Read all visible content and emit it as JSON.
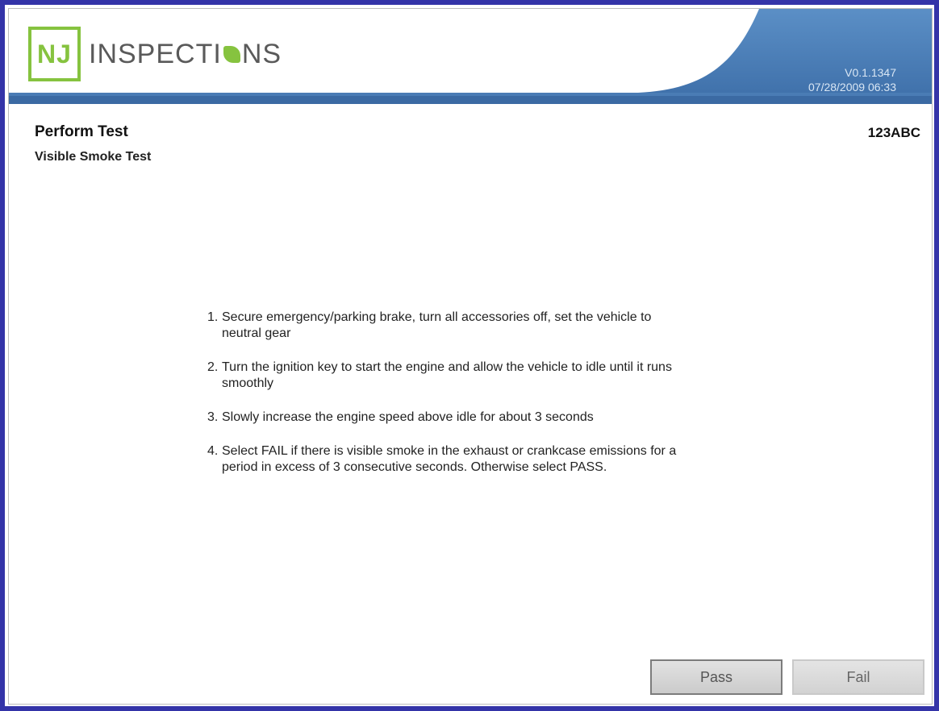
{
  "header": {
    "logo_prefix": "NJ",
    "logo_word_a": "INSPECTI",
    "logo_word_b": "NS",
    "version": "V0.1.1347",
    "datetime": "07/28/2009 06:33"
  },
  "page": {
    "title": "Perform Test",
    "subtitle": "Visible Smoke Test",
    "plate": "123ABC"
  },
  "instructions": [
    {
      "num": "1.",
      "text": "Secure emergency/parking brake, turn all accessories off, set the vehicle to neutral gear"
    },
    {
      "num": "2.",
      "text": "Turn the ignition key to start the engine and allow the vehicle to idle until it runs smoothly"
    },
    {
      "num": "3.",
      "text": "Slowly increase the engine speed above idle for about 3 seconds"
    },
    {
      "num": "4.",
      "text": "Select FAIL if there is visible smoke in the exhaust or crankcase emissions for a period in excess of 3 consecutive seconds. Otherwise select PASS."
    }
  ],
  "buttons": {
    "pass": "Pass",
    "fail": "Fail"
  },
  "colors": {
    "frame": "#3434a8",
    "brand_green": "#86c33f",
    "header_blue": "#4a7cb5"
  }
}
